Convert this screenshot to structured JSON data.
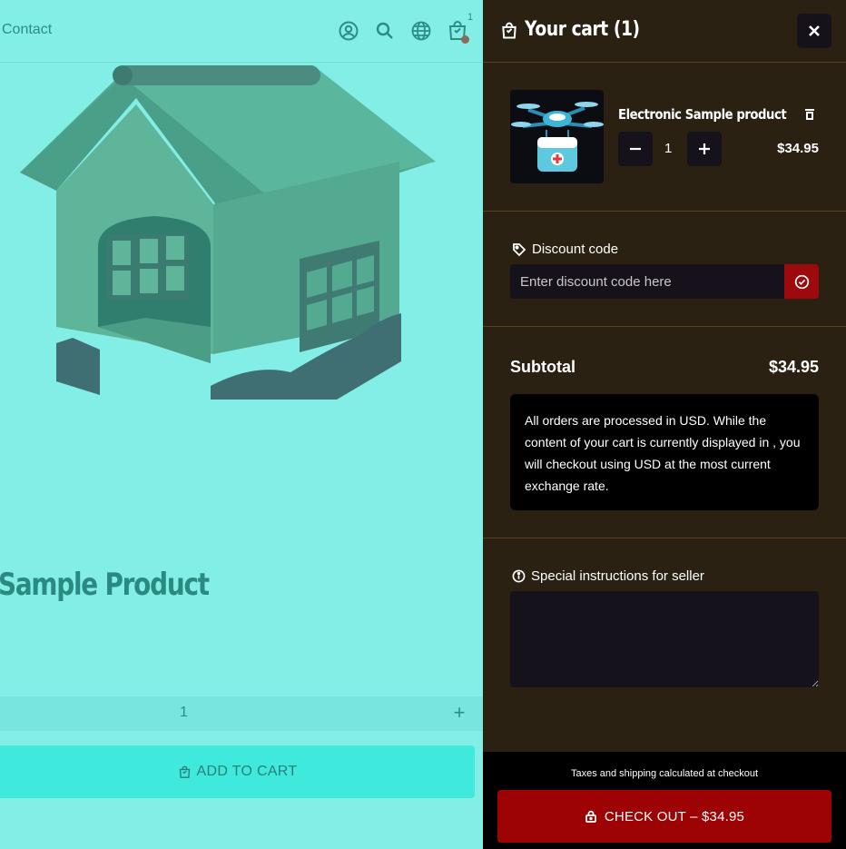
{
  "store": {
    "nav_contact": "Contact",
    "cart_count": "1",
    "product_title": "Sample Product",
    "quantity": "1",
    "add_to_cart_label": "ADD TO CART"
  },
  "cart": {
    "title": "Your cart (1)",
    "items": [
      {
        "name": "Electronic Sample product",
        "quantity": "1",
        "price": "$34.95"
      }
    ],
    "discount": {
      "label": "Discount code",
      "placeholder": "Enter discount code here"
    },
    "subtotal_label": "Subtotal",
    "subtotal_value": "$34.95",
    "currency_note": "All orders are processed in USD. While the content of your cart is currently displayed in , you will checkout using USD at the most current exchange rate.",
    "instructions_label": "Special instructions for seller",
    "tax_note": "Taxes and shipping calculated at checkout",
    "checkout_label": "CHECK OUT – $34.95"
  },
  "icons": {
    "account": "account-icon",
    "search": "search-icon",
    "globe": "globe-icon",
    "cart": "cart-icon",
    "close": "close-icon",
    "trash": "trash-icon",
    "tag": "tag-icon",
    "info": "info-icon",
    "lock": "lock-icon"
  },
  "colors": {
    "page_bg": "#83eee6",
    "drawer_bg": "#2a2113",
    "accent_red": "#9d0305",
    "add_to_cart_bg": "#3fe9dc"
  }
}
